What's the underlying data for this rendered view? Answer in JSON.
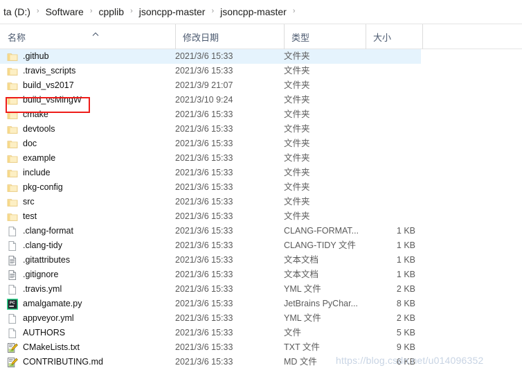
{
  "breadcrumb": {
    "items": [
      "ta (D:)",
      "Software",
      "cpplib",
      "jsoncpp-master",
      "jsoncpp-master"
    ],
    "separator": "›"
  },
  "columns": {
    "name": "名称",
    "date": "修改日期",
    "type": "类型",
    "size": "大小",
    "sort_indicator": "ascending"
  },
  "rows": [
    {
      "icon": "folder-icon",
      "name": ".github",
      "date": "2021/3/6 15:33",
      "type": "文件夹",
      "size": "",
      "selected": true
    },
    {
      "icon": "folder-icon",
      "name": ".travis_scripts",
      "date": "2021/3/6 15:33",
      "type": "文件夹",
      "size": "",
      "selected": false
    },
    {
      "icon": "folder-icon",
      "name": "build_vs2017",
      "date": "2021/3/9 21:07",
      "type": "文件夹",
      "size": "",
      "selected": false
    },
    {
      "icon": "folder-icon",
      "name": "build_vsMingW",
      "date": "2021/3/10 9:24",
      "type": "文件夹",
      "size": "",
      "selected": false
    },
    {
      "icon": "folder-icon",
      "name": "cmake",
      "date": "2021/3/6 15:33",
      "type": "文件夹",
      "size": "",
      "selected": false
    },
    {
      "icon": "folder-icon",
      "name": "devtools",
      "date": "2021/3/6 15:33",
      "type": "文件夹",
      "size": "",
      "selected": false
    },
    {
      "icon": "folder-icon",
      "name": "doc",
      "date": "2021/3/6 15:33",
      "type": "文件夹",
      "size": "",
      "selected": false
    },
    {
      "icon": "folder-icon",
      "name": "example",
      "date": "2021/3/6 15:33",
      "type": "文件夹",
      "size": "",
      "selected": false
    },
    {
      "icon": "folder-icon",
      "name": "include",
      "date": "2021/3/6 15:33",
      "type": "文件夹",
      "size": "",
      "selected": false
    },
    {
      "icon": "folder-icon",
      "name": "pkg-config",
      "date": "2021/3/6 15:33",
      "type": "文件夹",
      "size": "",
      "selected": false
    },
    {
      "icon": "folder-icon",
      "name": "src",
      "date": "2021/3/6 15:33",
      "type": "文件夹",
      "size": "",
      "selected": false
    },
    {
      "icon": "folder-icon",
      "name": "test",
      "date": "2021/3/6 15:33",
      "type": "文件夹",
      "size": "",
      "selected": false
    },
    {
      "icon": "blank-file-icon",
      "name": ".clang-format",
      "date": "2021/3/6 15:33",
      "type": "CLANG-FORMAT...",
      "size": "1 KB",
      "selected": false
    },
    {
      "icon": "blank-file-icon",
      "name": ".clang-tidy",
      "date": "2021/3/6 15:33",
      "type": "CLANG-TIDY 文件",
      "size": "1 KB",
      "selected": false
    },
    {
      "icon": "text-document-icon",
      "name": ".gitattributes",
      "date": "2021/3/6 15:33",
      "type": "文本文档",
      "size": "1 KB",
      "selected": false
    },
    {
      "icon": "text-document-icon",
      "name": ".gitignore",
      "date": "2021/3/6 15:33",
      "type": "文本文档",
      "size": "1 KB",
      "selected": false
    },
    {
      "icon": "blank-file-icon",
      "name": ".travis.yml",
      "date": "2021/3/6 15:33",
      "type": "YML 文件",
      "size": "2 KB",
      "selected": false
    },
    {
      "icon": "pycharm-icon",
      "name": "amalgamate.py",
      "date": "2021/3/6 15:33",
      "type": "JetBrains PyChar...",
      "size": "8 KB",
      "selected": false
    },
    {
      "icon": "blank-file-icon",
      "name": "appveyor.yml",
      "date": "2021/3/6 15:33",
      "type": "YML 文件",
      "size": "2 KB",
      "selected": false
    },
    {
      "icon": "blank-file-icon",
      "name": "AUTHORS",
      "date": "2021/3/6 15:33",
      "type": "文件",
      "size": "5 KB",
      "selected": false
    },
    {
      "icon": "notepadpp-icon",
      "name": "CMakeLists.txt",
      "date": "2021/3/6 15:33",
      "type": "TXT 文件",
      "size": "9 KB",
      "selected": false
    },
    {
      "icon": "notepadpp-icon",
      "name": "CONTRIBUTING.md",
      "date": "2021/3/6 15:33",
      "type": "MD 文件",
      "size": "6 KB",
      "selected": false
    }
  ],
  "annotation": {
    "type": "red-rectangle",
    "target": "build_vsMingW",
    "color": "#ee1c19"
  },
  "watermark": {
    "text": "https://blog.csdn.net/u014096352",
    "color": "#c8d4e4"
  },
  "theme": {
    "selection_color": "#e5f3fd",
    "header_text_color": "#4a586e",
    "folder_color": "#fbdf90"
  }
}
